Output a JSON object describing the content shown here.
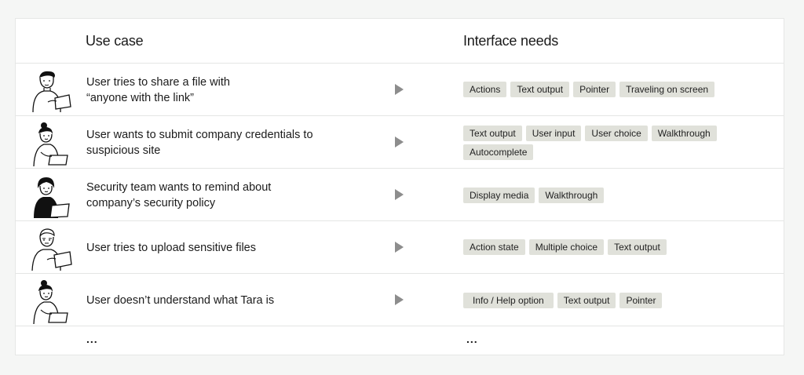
{
  "header": {
    "use_case": "Use case",
    "interface_needs": "Interface needs"
  },
  "rows": [
    {
      "avatar_icon": "person-with-laptop-icon",
      "lines": [
        "User tries to share a file with",
        "“anyone with the link”"
      ],
      "tags": [
        "Actions",
        "Text output",
        "Pointer",
        "Traveling on screen"
      ]
    },
    {
      "avatar_icon": "woman-with-laptop-icon",
      "lines": [
        "User wants to submit company credentials to",
        "suspicious site"
      ],
      "tags": [
        "Text output",
        "User input",
        "User choice",
        "Walkthrough",
        "Autocomplete"
      ]
    },
    {
      "avatar_icon": "woman-dark-outfit-laptop-icon",
      "lines": [
        "Security team wants to remind about",
        "company’s security policy"
      ],
      "tags": [
        "Display media",
        "Walkthrough"
      ]
    },
    {
      "avatar_icon": "man-with-laptop-icon",
      "lines": [
        "User tries to upload sensitive files"
      ],
      "tags": [
        "Action state",
        "Multiple choice",
        "Text output"
      ]
    },
    {
      "avatar_icon": "woman-with-laptop-icon",
      "lines": [
        "User doesn’t understand what Tara is"
      ],
      "tags": [
        "Info / Help option",
        "Text output",
        "Pointer"
      ]
    }
  ],
  "footer": {
    "use_case_ellipsis": "...",
    "needs_ellipsis": "..."
  },
  "colors": {
    "page_background": "#f5f6f5",
    "table_background": "#ffffff",
    "tag_background": "#e0e1da",
    "arrow": "#8d8d8d"
  }
}
